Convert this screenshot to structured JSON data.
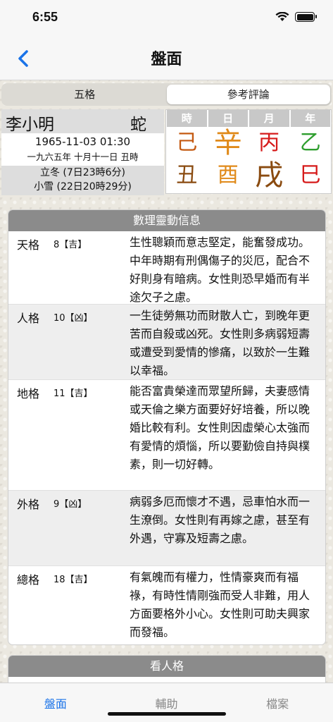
{
  "status": {
    "time": "6:55"
  },
  "nav": {
    "title": "盤面"
  },
  "segments": [
    {
      "label": "五格",
      "active": false
    },
    {
      "label": "參考評論",
      "active": true
    }
  ],
  "profile": {
    "name": "李小明",
    "zodiac": "蛇",
    "date": "1965-11-03 01:30",
    "lunar": "一九六五年 十月十一日 丑時",
    "term1": "立冬 (7日23時6分)",
    "term2": "小雪 (22日20時29分)"
  },
  "pillars": {
    "headers": [
      "時",
      "日",
      "月",
      "年"
    ],
    "stems": [
      {
        "char": "己",
        "color": "#c45a12"
      },
      {
        "char": "辛",
        "color": "#e08a1a"
      },
      {
        "char": "丙",
        "color": "#d61b1b"
      },
      {
        "char": "乙",
        "color": "#2e9e2e"
      }
    ],
    "branches": [
      {
        "char": "丑",
        "color": "#8a4b10"
      },
      {
        "char": "酉",
        "color": "#e08a1a"
      },
      {
        "char": "戌",
        "color": "#8a4b10"
      },
      {
        "char": "巳",
        "color": "#d61b1b"
      }
    ]
  },
  "card": {
    "title": "數理靈動信息",
    "rows": [
      {
        "name": "天格",
        "num": "8【吉】",
        "desc": "生性聰穎而意志堅定，能奮發成功。中年時期有刑偶傷子的災厄，配合不好則身有暗病。女性則恐早婚而有半途欠子之慮。"
      },
      {
        "name": "人格",
        "num": "10【凶】",
        "desc": "一生徒勞無功而財散人亡，到晚年更苦而自殺或凶死。女性則多病弱短壽或遭受到愛情的慘痛，以致於一生難以幸福。"
      },
      {
        "name": "地格",
        "num": "11【吉】",
        "desc": "能否富貴榮達而眾望所歸，夫妻感情或天倫之樂方面要好好培養，所以晚婚比較有利。女性則因虛榮心太強而有愛情的煩惱，所以要勤儉自持與樸素，則一切好轉。"
      },
      {
        "name": "外格",
        "num": "9【凶】",
        "desc": "病弱多厄而懷才不遇，忌車怕水而一生潦倒。女性則有再嫁之慮，甚至有外遇，守寡及短壽之慮。"
      },
      {
        "name": "總格",
        "num": "18【吉】",
        "desc": "有氣魄而有權力，性情豪爽而有福祿，有時性情剛強而受人非難，用人方面要格外小心。女性則可助夫興家而發福。"
      }
    ]
  },
  "card2": {
    "title": "看人格"
  },
  "tabs": [
    {
      "label": "盤面",
      "active": true
    },
    {
      "label": "輔助",
      "active": false
    },
    {
      "label": "檔案",
      "active": false
    }
  ]
}
